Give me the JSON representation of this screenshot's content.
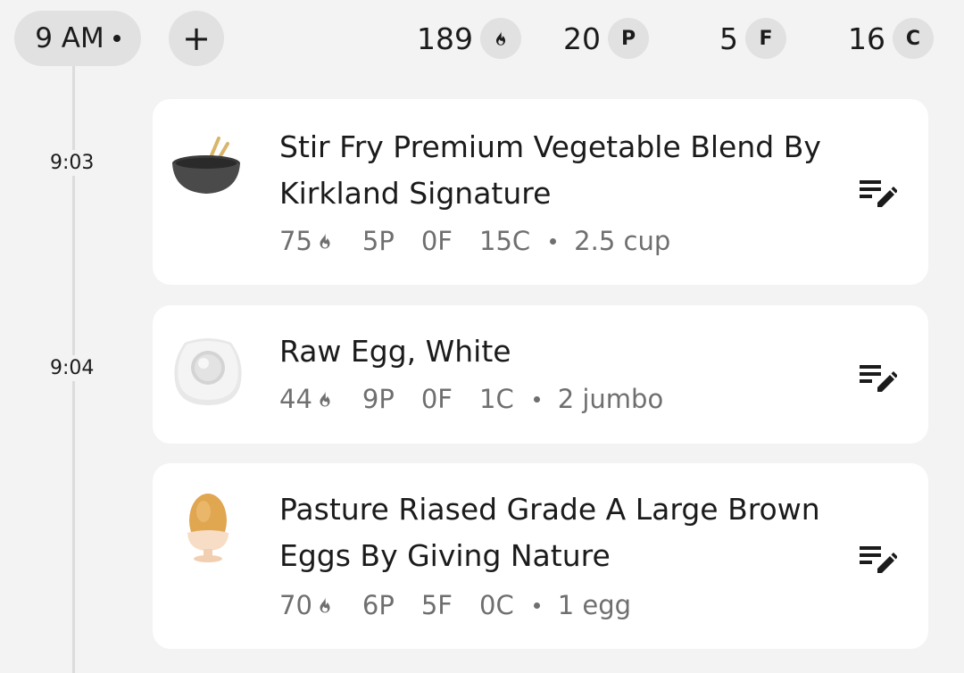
{
  "header": {
    "hour_label": "9 AM",
    "add_label": "+",
    "calories": "189",
    "protein": "20",
    "protein_badge": "P",
    "fat": "5",
    "fat_badge": "F",
    "carbs": "16",
    "carbs_badge": "C"
  },
  "entries": [
    {
      "time": "9:03",
      "icon": "bowl-chopsticks-icon",
      "title": "Stir Fry Premium Vegetable Blend By Kirkland Signature",
      "calories": "75",
      "protein": "5P",
      "fat": "0F",
      "carbs": "15C",
      "serving": "2.5 cup"
    },
    {
      "time": "9:04",
      "icon": "egg-icon",
      "title": "Raw Egg, White",
      "calories": "44",
      "protein": "9P",
      "fat": "0F",
      "carbs": "1C",
      "serving": "2 jumbo"
    },
    {
      "time": "",
      "icon": "boiled-egg-cup-icon",
      "title": "Pasture Riased Grade A Large Brown Eggs By Giving Nature",
      "calories": "70",
      "protein": "6P",
      "fat": "5F",
      "carbs": "0C",
      "serving": "1 egg"
    }
  ],
  "colors": {
    "background": "#f3f3f3",
    "card": "#ffffff",
    "pill": "#e1e1e1",
    "meta_text": "#6f6f6f"
  }
}
